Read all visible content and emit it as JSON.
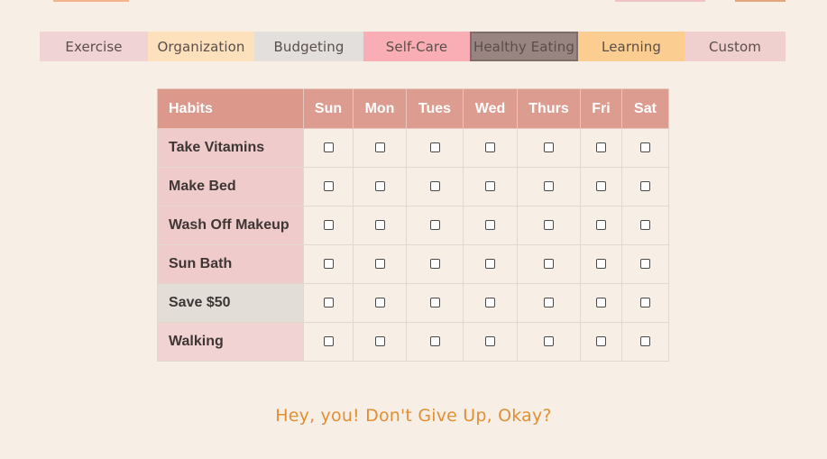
{
  "colors": {
    "page_background": "#f7efe6",
    "header_background": "#dd9c90",
    "footer_text": "#e18f35"
  },
  "tabs": [
    {
      "label": "Exercise",
      "color": "#f0d3d4"
    },
    {
      "label": "Organization",
      "color": "#fde0bc"
    },
    {
      "label": "Budgeting",
      "color": "#e2dfdd"
    },
    {
      "label": "Self-Care",
      "color": "#f8aeb4"
    },
    {
      "label": "Healthy Eating",
      "color": "#988581"
    },
    {
      "label": "Learning",
      "color": "#fccd90"
    },
    {
      "label": "Custom",
      "color": "#efd0cf"
    }
  ],
  "table": {
    "headers": {
      "habits": "Habits",
      "days": [
        "Sun",
        "Mon",
        "Tues",
        "Wed",
        "Thurs",
        "Fri",
        "Sat"
      ]
    },
    "rows": [
      {
        "habit": "Take Vitamins",
        "checked": [
          false,
          false,
          false,
          false,
          false,
          false,
          false
        ]
      },
      {
        "habit": "Make Bed",
        "checked": [
          false,
          false,
          false,
          false,
          false,
          false,
          false
        ]
      },
      {
        "habit": "Wash Off Makeup",
        "checked": [
          false,
          false,
          false,
          false,
          false,
          false,
          false
        ]
      },
      {
        "habit": "Sun Bath",
        "checked": [
          false,
          false,
          false,
          false,
          false,
          false,
          false
        ]
      },
      {
        "habit": "Save $50",
        "checked": [
          false,
          false,
          false,
          false,
          false,
          false,
          false
        ]
      },
      {
        "habit": "Walking",
        "checked": [
          false,
          false,
          false,
          false,
          false,
          false,
          false
        ]
      }
    ]
  },
  "footer": {
    "message": "Hey, you! Don't Give Up, Okay?"
  }
}
